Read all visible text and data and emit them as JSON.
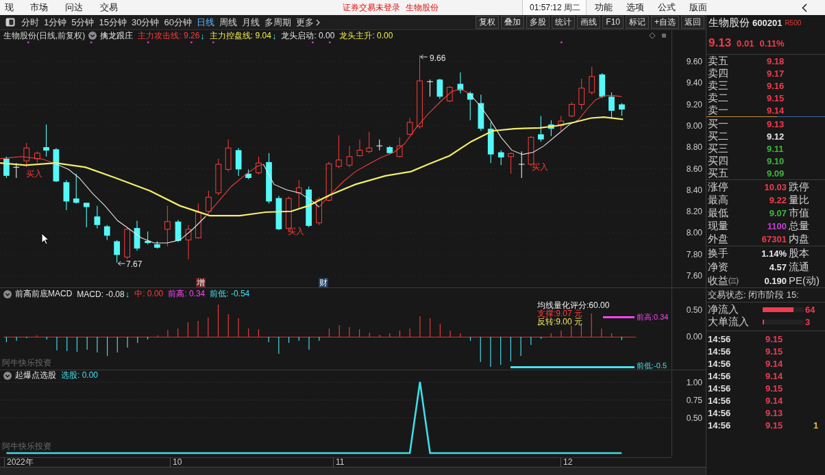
{
  "menu_bar": {
    "items": [
      "现",
      "市场",
      "问达",
      "交易"
    ],
    "notices": [
      "证券交易未登录",
      "生物股份"
    ],
    "clock": "01:57:12 周二",
    "right_items": [
      "功能",
      "选项",
      "公式",
      "版面"
    ]
  },
  "toolbar": {
    "periods": [
      {
        "label": "分时",
        "selected": false
      },
      {
        "label": "1分钟",
        "selected": false
      },
      {
        "label": "5分钟",
        "selected": false
      },
      {
        "label": "15分钟",
        "selected": false
      },
      {
        "label": "30分钟",
        "selected": false
      },
      {
        "label": "60分钟",
        "selected": false
      },
      {
        "label": "日线",
        "selected": true
      },
      {
        "label": "周线",
        "selected": false
      },
      {
        "label": "月线",
        "selected": false
      },
      {
        "label": "多周期",
        "selected": false
      }
    ],
    "more": "更多",
    "actions": [
      "复权",
      "叠加",
      "多股",
      "统计",
      "画线",
      "F10",
      "标记",
      "+自选",
      "返回"
    ]
  },
  "main_chart": {
    "title": "生物股份(日线,前复权)",
    "indicator": "擒龙跟庄",
    "readings": [
      {
        "text": "主力攻击线: 9.26",
        "color": "#ff3c3c",
        "arrow": "↓"
      },
      {
        "text": "主力控盘线: 9.04",
        "color": "#f2ee4a",
        "arrow": "↓"
      },
      {
        "text": "龙头启动: 0.00",
        "color": "#e6e6e6"
      },
      {
        "text": "龙头主升: 0.00",
        "color": "#f2ee4a"
      }
    ],
    "y_axis": [
      "9.60",
      "9.40",
      "9.20",
      "9.00",
      "8.80",
      "8.60",
      "8.40",
      "8.20",
      "8.00",
      "7.80",
      "7.60"
    ],
    "price_markers": [
      "9.66",
      "7.67"
    ],
    "signals": [
      "买入",
      "买入",
      "买入"
    ],
    "event_tags": [
      {
        "text": "增",
        "color": "#6a1e1e"
      },
      {
        "text": "财",
        "color": "#1e3c5c"
      }
    ]
  },
  "macd_panel": {
    "indicator": "前高前底MACD",
    "readings": [
      {
        "text": "MACD: -0.08",
        "color": "#e6e6e6",
        "arrow": "↓"
      },
      {
        "text": "中: 0.00",
        "color": "#ff3c3c"
      },
      {
        "text": "前高: 0.34",
        "color": "#ff44ff"
      },
      {
        "text": "前低: -0.54",
        "color": "#44e4f0"
      }
    ],
    "overlay_texts": [
      {
        "text": "均线量化评分:60.00",
        "color": "#f0f0f0"
      },
      {
        "text": "支撑:9.07 元",
        "color": "#ff3c3c"
      },
      {
        "text": "反转:9.00 元",
        "color": "#f2ea5a"
      }
    ],
    "level_lines": [
      {
        "kind": "high",
        "label": "前高:0.34"
      },
      {
        "kind": "low",
        "label": "前低:-0.5"
      }
    ],
    "caption": "阿牛快乐投资",
    "y_axis": [
      "0.50",
      "0.00"
    ]
  },
  "signal_panel": {
    "indicator": "起爆点选股",
    "readings": [
      {
        "text": "选股: 0.00",
        "color": "#44e4f0"
      }
    ],
    "caption": "阿牛快乐投资",
    "chart_data": {
      "type": "line",
      "categories": [
        null,
        null,
        null,
        null,
        null,
        null,
        null,
        null,
        null,
        null,
        null,
        null,
        null,
        null,
        null,
        null,
        null,
        null,
        null,
        null,
        null,
        null,
        null,
        null,
        null,
        null,
        null,
        null,
        null,
        null,
        null,
        null,
        null,
        null,
        null,
        null,
        null,
        null,
        null,
        null,
        null,
        null,
        null,
        null,
        null,
        null,
        null,
        null,
        null,
        null,
        null,
        null,
        null,
        null,
        null,
        null,
        null,
        null,
        null,
        null,
        null,
        null
      ],
      "ylim": [
        -0.058,
        1.019
      ],
      "yticks": [
        {
          "value": 1,
          "label": "1.00"
        },
        {
          "value": 0.75,
          "label": "0.75"
        },
        {
          "value": 0.5,
          "label": "0.50"
        }
      ],
      "series": [
        {
          "color": "#3fdde6",
          "values": [
            0,
            0,
            0,
            0,
            0,
            0,
            0,
            0,
            0,
            0,
            0,
            0,
            0,
            0,
            0,
            0,
            0,
            0,
            0,
            0,
            0,
            0,
            0,
            0,
            0,
            0,
            0,
            0,
            0,
            0,
            0,
            0,
            0,
            0,
            0,
            0,
            0,
            0,
            0,
            0,
            0,
            1,
            0,
            0,
            0,
            0,
            0,
            0,
            0,
            0,
            0,
            0,
            0,
            0,
            0,
            0,
            0,
            0,
            0,
            0,
            0,
            0
          ]
        }
      ]
    }
  },
  "date_axis": [
    "2022年",
    "10",
    "11",
    "12"
  ],
  "quote": {
    "name": "生物股份",
    "code": "600201",
    "badge": "R500",
    "price": "9.13",
    "change": "0.01",
    "change_pct": "0.11%",
    "asks": [
      {
        "label": "卖五",
        "price": "9.18",
        "color": "#f03c50"
      },
      {
        "label": "卖四",
        "price": "9.17",
        "color": "#f03c50"
      },
      {
        "label": "卖三",
        "price": "9.16",
        "color": "#f03c50"
      },
      {
        "label": "卖二",
        "price": "9.15",
        "color": "#f03c50"
      },
      {
        "label": "卖一",
        "price": "9.14",
        "color": "#f03c50"
      }
    ],
    "bids": [
      {
        "label": "买一",
        "price": "9.13",
        "color": "#f03c50"
      },
      {
        "label": "买二",
        "price": "9.12",
        "color": "#e6e6e6"
      },
      {
        "label": "买三",
        "price": "9.11",
        "color": "#3cb83c"
      },
      {
        "label": "买四",
        "price": "9.10",
        "color": "#3cb83c"
      },
      {
        "label": "买五",
        "price": "9.09",
        "color": "#3cb83c"
      }
    ],
    "stats": [
      {
        "label": "涨停",
        "value": "10.03",
        "color": "#f03c50",
        "label_2": "跌停"
      },
      {
        "label": "最高",
        "value": "9.22",
        "color": "#f03c50",
        "label_2": "量比"
      },
      {
        "label": "最低",
        "value": "9.07",
        "color": "#3cb83c",
        "label_2": "市值"
      },
      {
        "label": "现量",
        "value": "1100",
        "color": "#c040d0",
        "label_2": "总量"
      },
      {
        "label": "外盘",
        "value": "67301",
        "color": "#f03c50",
        "label_2": "内盘"
      }
    ],
    "fundamentals": [
      {
        "label": "换手",
        "value": "1.14%",
        "label_2": "股本"
      },
      {
        "label": "净资",
        "value": "4.57",
        "label_2": "流通"
      },
      {
        "label": "收益㈢",
        "value": "0.190",
        "label_2": "PE(动)"
      }
    ],
    "trade_status": "交易状态: 闭市阶段 15:",
    "flows": [
      {
        "label": "净流入",
        "level": 0.75,
        "value": "64"
      },
      {
        "label": "大单流入",
        "level": 0.04,
        "value": "3"
      }
    ],
    "ticks": [
      {
        "time": "14:56",
        "price": "9.15"
      },
      {
        "time": "14:56",
        "price": "9.15"
      },
      {
        "time": "14:56",
        "price": "9.14"
      },
      {
        "time": "14:56",
        "price": "9.14"
      },
      {
        "time": "14:56",
        "price": "9.15"
      },
      {
        "time": "14:56",
        "price": "9.14"
      },
      {
        "time": "14:56",
        "price": "9.13"
      },
      {
        "time": "14:56",
        "price": "9.15",
        "volume": "1"
      }
    ]
  }
}
